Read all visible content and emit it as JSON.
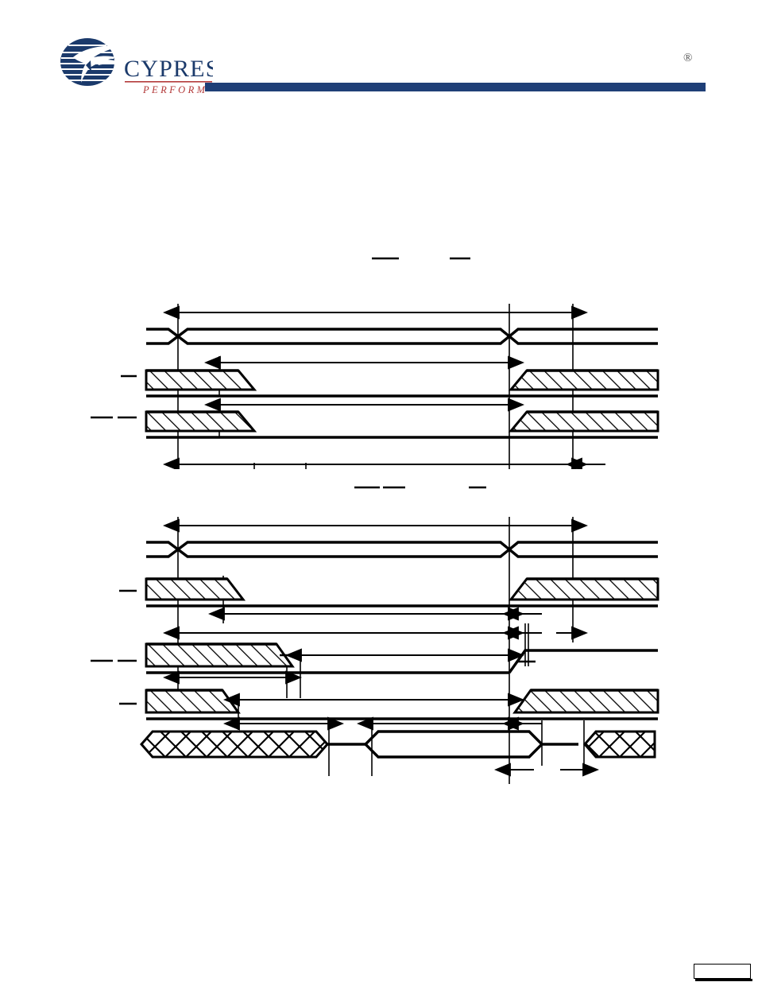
{
  "document": {
    "vendor": "Cypress",
    "vendor_tagline": "PERFORM",
    "registered_mark": "®",
    "brand_bar_color": "#1f3f77",
    "logo_text_color": "#1b3a6b",
    "tagline_color": "#b33a3a",
    "page_number": ""
  },
  "figures": [
    {
      "id": "figure-1",
      "title_overlines": 2,
      "title": "",
      "signals": [
        {
          "name": "address",
          "label": "",
          "overlined": false,
          "type": "bus-cross"
        },
        {
          "name": "chip-enable",
          "label": "",
          "overlined": true,
          "type": "hatched-low"
        },
        {
          "name": "output-enable",
          "label": "",
          "overlined": true,
          "type": "hatched-low"
        },
        {
          "name": "write-enable",
          "label": "",
          "overlined": true,
          "type": "pulse-low"
        },
        {
          "name": "data-io",
          "label": "",
          "overlined": false,
          "type": "data-bus"
        }
      ],
      "dimension_lines": [
        {
          "name": "t-cycle",
          "label": "",
          "row": "top"
        },
        {
          "name": "t-ce-low",
          "label": "",
          "row": "ce"
        },
        {
          "name": "t-oe-low",
          "label": "",
          "row": "oe"
        },
        {
          "name": "t-setup",
          "label": "",
          "row": "we-upper"
        },
        {
          "name": "t-pulse",
          "label": "",
          "row": "we-lower"
        },
        {
          "name": "t-hold",
          "label": "",
          "row": "we-lower"
        },
        {
          "name": "t-data-valid",
          "label": "",
          "row": "data"
        },
        {
          "name": "t-data-hold",
          "label": "",
          "row": "data-bottom"
        },
        {
          "name": "t-high-z",
          "label": "",
          "row": "data-bottom"
        }
      ]
    },
    {
      "id": "figure-2",
      "title_overlines": 3,
      "title": "",
      "signals": [
        {
          "name": "address",
          "label": "",
          "overlined": false,
          "type": "bus-cross"
        },
        {
          "name": "chip-enable",
          "label": "",
          "overlined": true,
          "type": "hatched-low"
        },
        {
          "name": "write-enable",
          "label": "",
          "overlined": true,
          "type": "hatched-low"
        },
        {
          "name": "output-enable",
          "label": "",
          "overlined": true,
          "type": "hatched-low"
        },
        {
          "name": "data-io",
          "label": "",
          "overlined": false,
          "type": "data-bus"
        }
      ],
      "dimension_lines": [
        {
          "name": "t-cycle",
          "label": "",
          "row": "top"
        },
        {
          "name": "t-ce-low",
          "label": "",
          "row": "ce"
        },
        {
          "name": "t-we-setup",
          "label": "",
          "row": "we"
        },
        {
          "name": "t-we-pulse",
          "label": "",
          "row": "we"
        },
        {
          "name": "t-oe-low",
          "label": "",
          "row": "oe"
        },
        {
          "name": "t-data-setup",
          "label": "",
          "row": "data"
        },
        {
          "name": "t-data-hold",
          "label": "",
          "row": "data-bottom"
        },
        {
          "name": "t-high-z",
          "label": "",
          "row": "data-bottom"
        }
      ]
    }
  ]
}
